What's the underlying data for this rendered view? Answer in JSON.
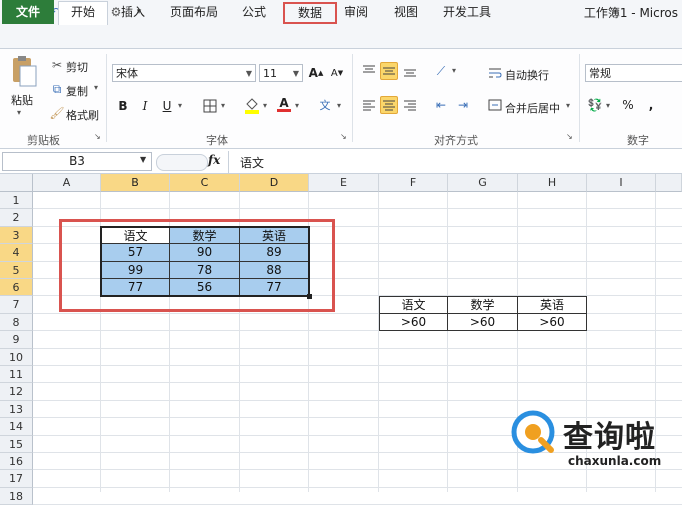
{
  "window": {
    "title": "工作簿1 - Micros"
  },
  "tabs": [
    {
      "id": "file",
      "label": "文件"
    },
    {
      "id": "home",
      "label": "开始"
    },
    {
      "id": "insert",
      "label": "插入"
    },
    {
      "id": "layout",
      "label": "页面布局"
    },
    {
      "id": "formula",
      "label": "公式"
    },
    {
      "id": "data",
      "label": "数据"
    },
    {
      "id": "review",
      "label": "审阅"
    },
    {
      "id": "view",
      "label": "视图"
    },
    {
      "id": "dev",
      "label": "开发工具"
    }
  ],
  "ribbon": {
    "clipboard": {
      "paste": "粘贴",
      "cut": "剪切",
      "copy": "复制",
      "format_painter": "格式刷",
      "group": "剪贴板"
    },
    "font": {
      "name": "宋体",
      "size": "11",
      "bold": "B",
      "italic": "I",
      "underline": "U",
      "grow": "A",
      "shrink": "A",
      "font_color": "A",
      "phonetic": "文",
      "group": "字体"
    },
    "alignment": {
      "wrap": "自动换行",
      "merge": "合并后居中",
      "group": "对齐方式"
    },
    "number": {
      "format": "常规",
      "percent": "%",
      "comma": ",",
      "group": "数字"
    }
  },
  "formula_bar": {
    "name_box": "B3",
    "fx": "fx",
    "content": "语文"
  },
  "columns": [
    "A",
    "B",
    "C",
    "D",
    "E",
    "F",
    "G",
    "H",
    "I"
  ],
  "rows": [
    "1",
    "2",
    "3",
    "4",
    "5",
    "6",
    "7",
    "8",
    "9",
    "10",
    "11",
    "12",
    "13",
    "14",
    "15",
    "16",
    "17",
    "18"
  ],
  "table1": [
    [
      "语文",
      "数学",
      "英语"
    ],
    [
      "57",
      "90",
      "89"
    ],
    [
      "99",
      "78",
      "88"
    ],
    [
      "77",
      "56",
      "77"
    ]
  ],
  "table2": [
    [
      "语文",
      "数学",
      "英语"
    ],
    [
      ">60",
      ">60",
      ">60"
    ]
  ],
  "watermark": {
    "text": "查询啦",
    "url": "chaxunla.com"
  },
  "colors": {
    "file_tab": "#2d7d3a",
    "highlight_red": "#d9534f",
    "selected_fill": "#a8cdee",
    "header_selected": "#f9d886"
  }
}
